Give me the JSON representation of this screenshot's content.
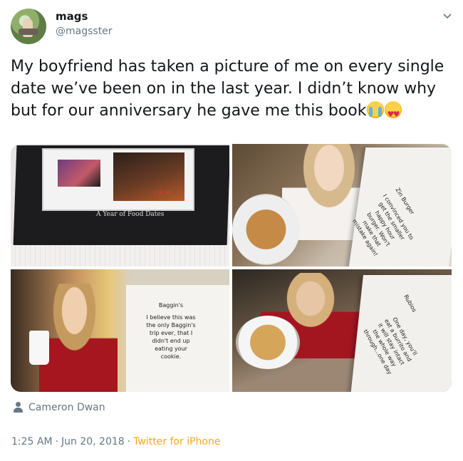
{
  "author": {
    "display_name": "mags",
    "handle": "@magsster"
  },
  "tweet": {
    "text": "My boyfriend has taken a picture of me on every single date we’ve been on in the last year. I didn’t know why but for our anniversary he gave me this book",
    "emojis": [
      "loudly-crying-face",
      "heart-eyes-face"
    ]
  },
  "photos": [
    {
      "book_title": "A Year of Food Dates",
      "date": "3 18 '18"
    },
    {
      "page_title": "Zin Burger",
      "page_text": "I convinced you to\nget the smaller\nhappy hour\nburger. Won't\nmake that\nmistake again!"
    },
    {
      "page_title": "Baggin's",
      "page_text": "I believe this was\nthe only Baggin's\ntrip ever, that I\ndidn't end up\neating your\ncookie."
    },
    {
      "page_title": "Rubios",
      "page_text": "One day, you'll\neat a burrito and\nit will stay intact\nthe whole way\nthrough...one day"
    }
  ],
  "tagged_user": "Cameron Dwan",
  "meta": {
    "time": "1:25 AM",
    "separator": "·",
    "date": "Jun 20, 2018",
    "source": "Twitter for iPhone"
  },
  "colors": {
    "text": "#14171a",
    "secondary": "#657786",
    "source_link": "#f5a623"
  }
}
